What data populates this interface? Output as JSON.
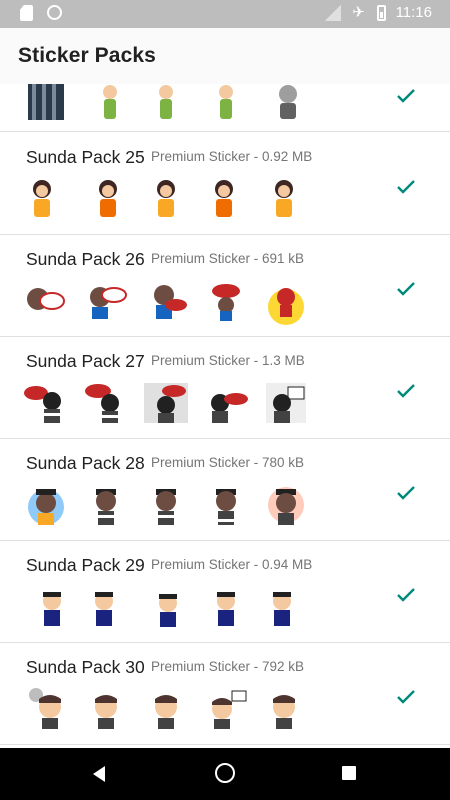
{
  "status_bar": {
    "time": "11:16",
    "icons": [
      "sd-card-icon",
      "circle-icon",
      "no-signal-icon",
      "airplane-icon",
      "battery-charging-icon"
    ]
  },
  "app": {
    "title": "Sticker Packs"
  },
  "colors": {
    "accent": "#00897b",
    "divider": "#e0e0e0",
    "status_bar": "#bdbdbd",
    "nav_bar": "#000000"
  },
  "packs": [
    {
      "name": "Sunda Pack 25",
      "meta": "Premium Sticker - 0.92 MB",
      "status_icon": "check-icon"
    },
    {
      "name": "Sunda Pack 26",
      "meta": "Premium Sticker - 691 kB",
      "status_icon": "check-icon"
    },
    {
      "name": "Sunda Pack 27",
      "meta": "Premium Sticker - 1.3 MB",
      "status_icon": "check-icon"
    },
    {
      "name": "Sunda Pack 28",
      "meta": "Premium Sticker - 780 kB",
      "status_icon": "check-icon"
    },
    {
      "name": "Sunda Pack 29",
      "meta": "Premium Sticker - 0.94 MB",
      "status_icon": "check-icon"
    },
    {
      "name": "Sunda Pack 30",
      "meta": "Premium Sticker - 792 kB",
      "status_icon": "check-icon"
    }
  ],
  "nav": {
    "icons": [
      "back-icon",
      "home-icon",
      "recents-icon"
    ]
  }
}
